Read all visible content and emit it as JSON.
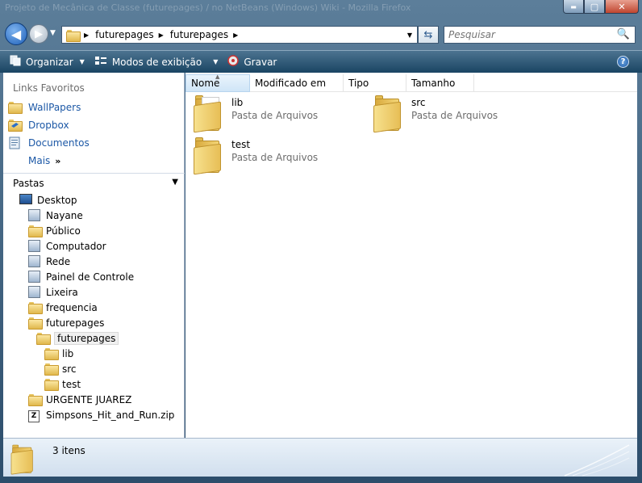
{
  "window": {
    "title": "Projeto de Mecânica de Classe (futurepages) / no NetBeans (Windows) Wiki - Mozilla Firefox",
    "min_glyph": "▬",
    "max_glyph": "▢",
    "close_glyph": "✕"
  },
  "address": {
    "crumbs": [
      "futurepages",
      "futurepages"
    ]
  },
  "search": {
    "placeholder": "Pesquisar"
  },
  "toolbar": {
    "organize_label": "Organizar",
    "views_label": "Modos de exibição",
    "burn_label": "Gravar",
    "help_glyph": "?"
  },
  "nav": {
    "favorites_title": "Links Favoritos",
    "favorites": [
      {
        "label": "WallPapers",
        "icon": "folder-icon"
      },
      {
        "label": "Dropbox",
        "icon": "dropbox-icon"
      },
      {
        "label": "Documentos",
        "icon": "documents-icon"
      }
    ],
    "more_label": "Mais",
    "folders_title": "Pastas",
    "tree": [
      {
        "label": "Desktop",
        "icon": "desktop-icon",
        "level": 0
      },
      {
        "label": "Nayane",
        "icon": "user-folder-icon",
        "level": 1
      },
      {
        "label": "Público",
        "icon": "folder-icon",
        "level": 1
      },
      {
        "label": "Computador",
        "icon": "computer-icon",
        "level": 1
      },
      {
        "label": "Rede",
        "icon": "network-icon",
        "level": 1
      },
      {
        "label": "Painel de Controle",
        "icon": "control-panel-icon",
        "level": 1
      },
      {
        "label": "Lixeira",
        "icon": "recycle-bin-icon",
        "level": 1
      },
      {
        "label": "frequencia",
        "icon": "folder-icon",
        "level": 1
      },
      {
        "label": "futurepages",
        "icon": "folder-icon",
        "level": 1
      },
      {
        "label": "futurepages",
        "icon": "folder-icon",
        "level": 2,
        "selected": true
      },
      {
        "label": "lib",
        "icon": "folder-icon",
        "level": 3
      },
      {
        "label": "src",
        "icon": "folder-icon",
        "level": 3
      },
      {
        "label": "test",
        "icon": "folder-icon",
        "level": 3
      },
      {
        "label": "URGENTE JUAREZ",
        "icon": "folder-icon",
        "level": 1
      },
      {
        "label": "Simpsons_Hit_and_Run.zip",
        "icon": "zip-icon",
        "level": 1
      }
    ]
  },
  "columns": [
    "Nome",
    "Modificado em",
    "Tipo",
    "Tamanho"
  ],
  "items": [
    {
      "name": "lib",
      "type": "Pasta de Arquivos"
    },
    {
      "name": "src",
      "type": "Pasta de Arquivos"
    },
    {
      "name": "test",
      "type": "Pasta de Arquivos"
    }
  ],
  "status": {
    "count": "3 itens"
  }
}
